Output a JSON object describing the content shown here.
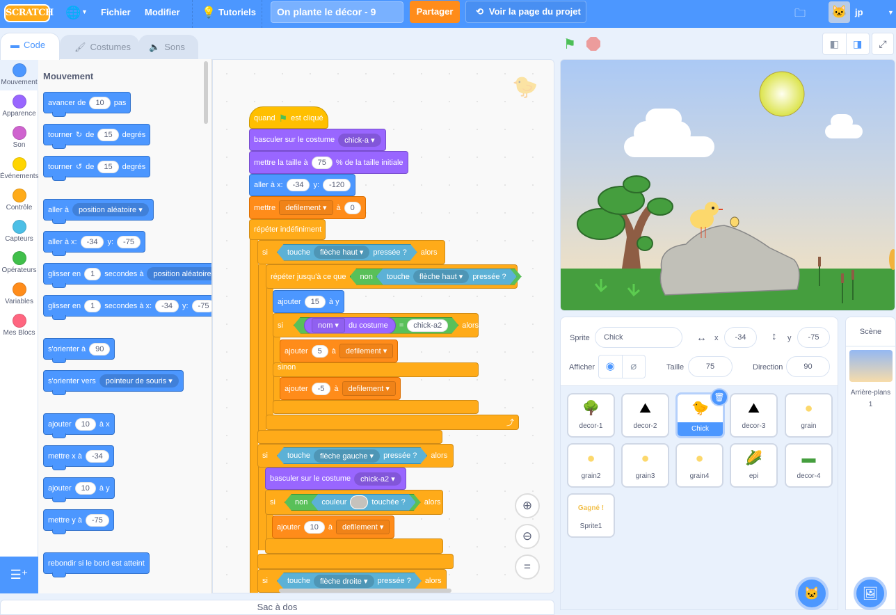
{
  "topbar": {
    "logo": "SCRATCH",
    "language_icon": "globe-icon",
    "menu": [
      "Fichier",
      "Modifier"
    ],
    "tutorials": "Tutoriels",
    "project_title": "On plante le décor - 9",
    "share": "Partager",
    "see_project_page": "Voir la page du projet",
    "username": "jp"
  },
  "tabs": [
    "Code",
    "Costumes",
    "Sons"
  ],
  "categories": [
    {
      "label": "Mouvement",
      "color": "#4c97ff"
    },
    {
      "label": "Apparence",
      "color": "#9966ff"
    },
    {
      "label": "Son",
      "color": "#cf63cf"
    },
    {
      "label": "Événements",
      "color": "#ffd500"
    },
    {
      "label": "Contrôle",
      "color": "#ffab19"
    },
    {
      "label": "Capteurs",
      "color": "#4cbfe6"
    },
    {
      "label": "Opérateurs",
      "color": "#40bf4a"
    },
    {
      "label": "Variables",
      "color": "#ff8c1a"
    },
    {
      "label": "Mes Blocs",
      "color": "#ff6680"
    }
  ],
  "palette": {
    "title": "Mouvement",
    "blocks": {
      "move": {
        "a": "avancer de",
        "v": "10",
        "b": "pas"
      },
      "turn_right": {
        "a": "tourner",
        "icon": "↻",
        "b": "de",
        "v": "15",
        "c": "degrés"
      },
      "turn_left": {
        "a": "tourner",
        "icon": "↺",
        "b": "de",
        "v": "15",
        "c": "degrés"
      },
      "goto": {
        "a": "aller à",
        "d": "position aléatoire"
      },
      "goto_xy": {
        "a": "aller à x:",
        "x": "-34",
        "b": "y:",
        "y": "-75"
      },
      "glide": {
        "a": "glisser en",
        "v": "1",
        "b": "secondes à",
        "d": "position aléatoire"
      },
      "glide_xy": {
        "a": "glisser en",
        "v": "1",
        "b": "secondes à x:",
        "x": "-34",
        "c": "y:",
        "y": "-75"
      },
      "point_dir": {
        "a": "s'orienter à",
        "v": "90"
      },
      "point_towards": {
        "a": "s'orienter vers",
        "d": "pointeur de souris"
      },
      "change_x": {
        "a": "ajouter",
        "v": "10",
        "b": "à x"
      },
      "set_x": {
        "a": "mettre x à",
        "v": "-34"
      },
      "change_y": {
        "a": "ajouter",
        "v": "10",
        "b": "à y"
      },
      "set_y": {
        "a": "mettre y à",
        "v": "-75"
      },
      "bounce": {
        "a": "rebondir si le bord est atteint"
      }
    }
  },
  "script": {
    "hat": {
      "a": "quand",
      "b": "est cliqué"
    },
    "costume1": {
      "a": "basculer sur le costume",
      "d": "chick-a"
    },
    "size": {
      "a": "mettre la taille à",
      "v": "75",
      "b": "% de la taille initiale"
    },
    "goto": {
      "a": "aller à x:",
      "x": "-34",
      "b": "y:",
      "y": "-120"
    },
    "setvar": {
      "a": "mettre",
      "d": "defilement",
      "b": "à",
      "v": "0"
    },
    "forever": "répéter indéfiniment",
    "if1": {
      "si": "si",
      "touche": "touche",
      "key": "flèche haut",
      "pressed": "pressée ?",
      "alors": "alors"
    },
    "until": {
      "a": "répéter jusqu'à ce que",
      "non": "non",
      "touche": "touche",
      "key": "flèche haut",
      "pressed": "pressée ?"
    },
    "change_y": {
      "a": "ajouter",
      "v": "15",
      "b": "à y"
    },
    "if2": {
      "si": "si",
      "d": "nom",
      "b": "du costume",
      "eq": "=",
      "v": "chick-a2",
      "alors": "alors"
    },
    "add5": {
      "a": "ajouter",
      "v": "5",
      "b": "à",
      "d": "defilement"
    },
    "else": "sinon",
    "addm5": {
      "a": "ajouter",
      "v": "-5",
      "b": "à",
      "d": "defilement"
    },
    "if3": {
      "si": "si",
      "touche": "touche",
      "key": "flèche gauche",
      "pressed": "pressée ?",
      "alors": "alors"
    },
    "costume2": {
      "a": "basculer sur le costume",
      "d": "chick-a2"
    },
    "if4": {
      "si": "si",
      "non": "non",
      "couleur": "couleur",
      "touched": "touchée ?",
      "alors": "alors"
    },
    "add10": {
      "a": "ajouter",
      "v": "10",
      "b": "à",
      "d": "defilement"
    },
    "if5": {
      "si": "si",
      "touche": "touche",
      "key": "flèche droite",
      "pressed": "pressée ?",
      "alors": "alors"
    }
  },
  "zoom_controls": {
    "zoom_in": "zoom-in-icon",
    "zoom_out": "zoom-out-icon",
    "reset": "="
  },
  "backpack": "Sac à dos",
  "sprite_info": {
    "sprite_label": "Sprite",
    "sprite_name": "Chick",
    "x_label": "x",
    "x": "-34",
    "y_label": "y",
    "y": "-75",
    "show_label": "Afficher",
    "size_label": "Taille",
    "size": "75",
    "direction_label": "Direction",
    "direction": "90"
  },
  "sprites": [
    {
      "name": "decor-1",
      "icon": "🌳"
    },
    {
      "name": "decor-2",
      "icon": "⛰"
    },
    {
      "name": "Chick",
      "icon": "🐤",
      "selected": true
    },
    {
      "name": "decor-3",
      "icon": "⛰"
    },
    {
      "name": "grain",
      "icon": "●"
    },
    {
      "name": "grain2",
      "icon": "●"
    },
    {
      "name": "grain3",
      "icon": "●"
    },
    {
      "name": "grain4",
      "icon": "●"
    },
    {
      "name": "epi",
      "icon": "🌽"
    },
    {
      "name": "decor-4",
      "icon": "▬"
    },
    {
      "name": "Sprite1",
      "icon": "Gagné !"
    }
  ],
  "scene": {
    "title": "Scène",
    "backdrops_label": "Arrière-plans",
    "backdrops_count": "1"
  }
}
